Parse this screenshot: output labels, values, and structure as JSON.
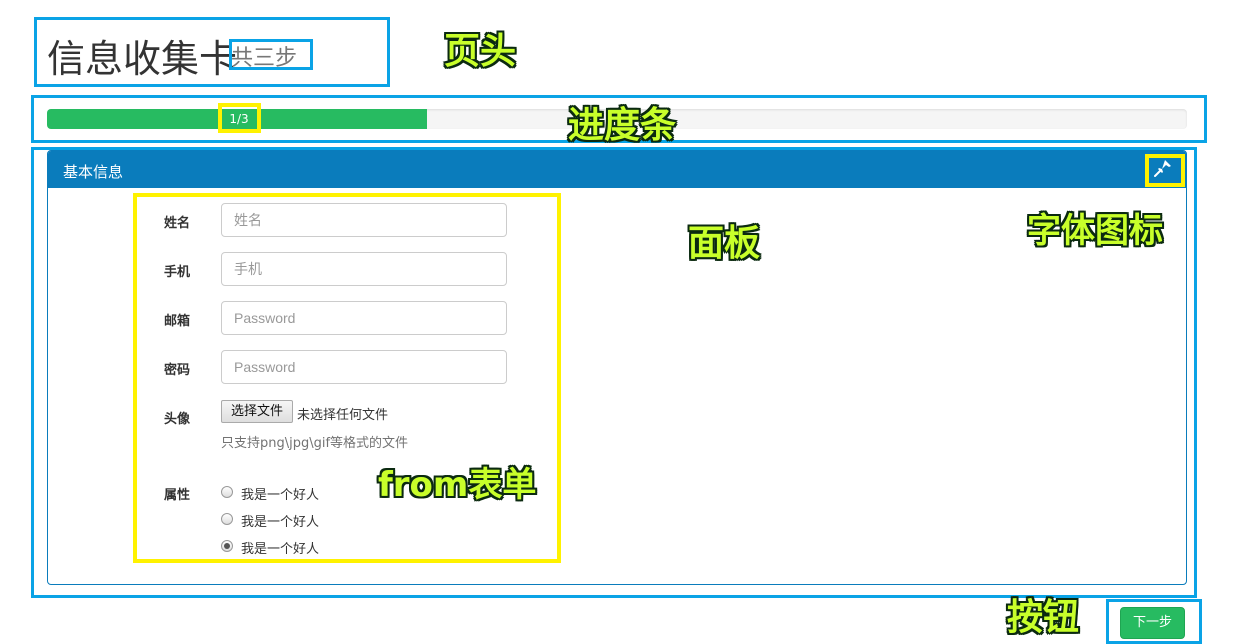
{
  "header": {
    "title": "信息收集卡",
    "subtitle": "共三步"
  },
  "progress": {
    "label": "1/3",
    "fraction": 0.333,
    "color": "#27bb61"
  },
  "panel": {
    "title": "基本信息",
    "pin_icon": "pushpin-icon",
    "heading_color": "#0a7cbc"
  },
  "form": {
    "name": {
      "label": "姓名",
      "placeholder": "姓名"
    },
    "phone": {
      "label": "手机",
      "placeholder": "手机"
    },
    "email": {
      "label": "邮箱",
      "placeholder": "Password"
    },
    "password": {
      "label": "密码",
      "placeholder": "Password"
    },
    "avatar": {
      "label": "头像",
      "button": "选择文件",
      "status": "未选择任何文件",
      "help": "只支持png\\jpg\\gif等格式的文件"
    },
    "attr": {
      "label": "属性",
      "options": [
        {
          "label": "我是一个好人",
          "checked": false
        },
        {
          "label": "我是一个好人",
          "checked": false
        },
        {
          "label": "我是一个好人",
          "checked": true
        }
      ]
    }
  },
  "next_button": "下一步",
  "annotations": {
    "header": "页头",
    "progress": "进度条",
    "panel": "面板",
    "font_icon": "字体图标",
    "form": "from表单",
    "button": "按钮"
  }
}
